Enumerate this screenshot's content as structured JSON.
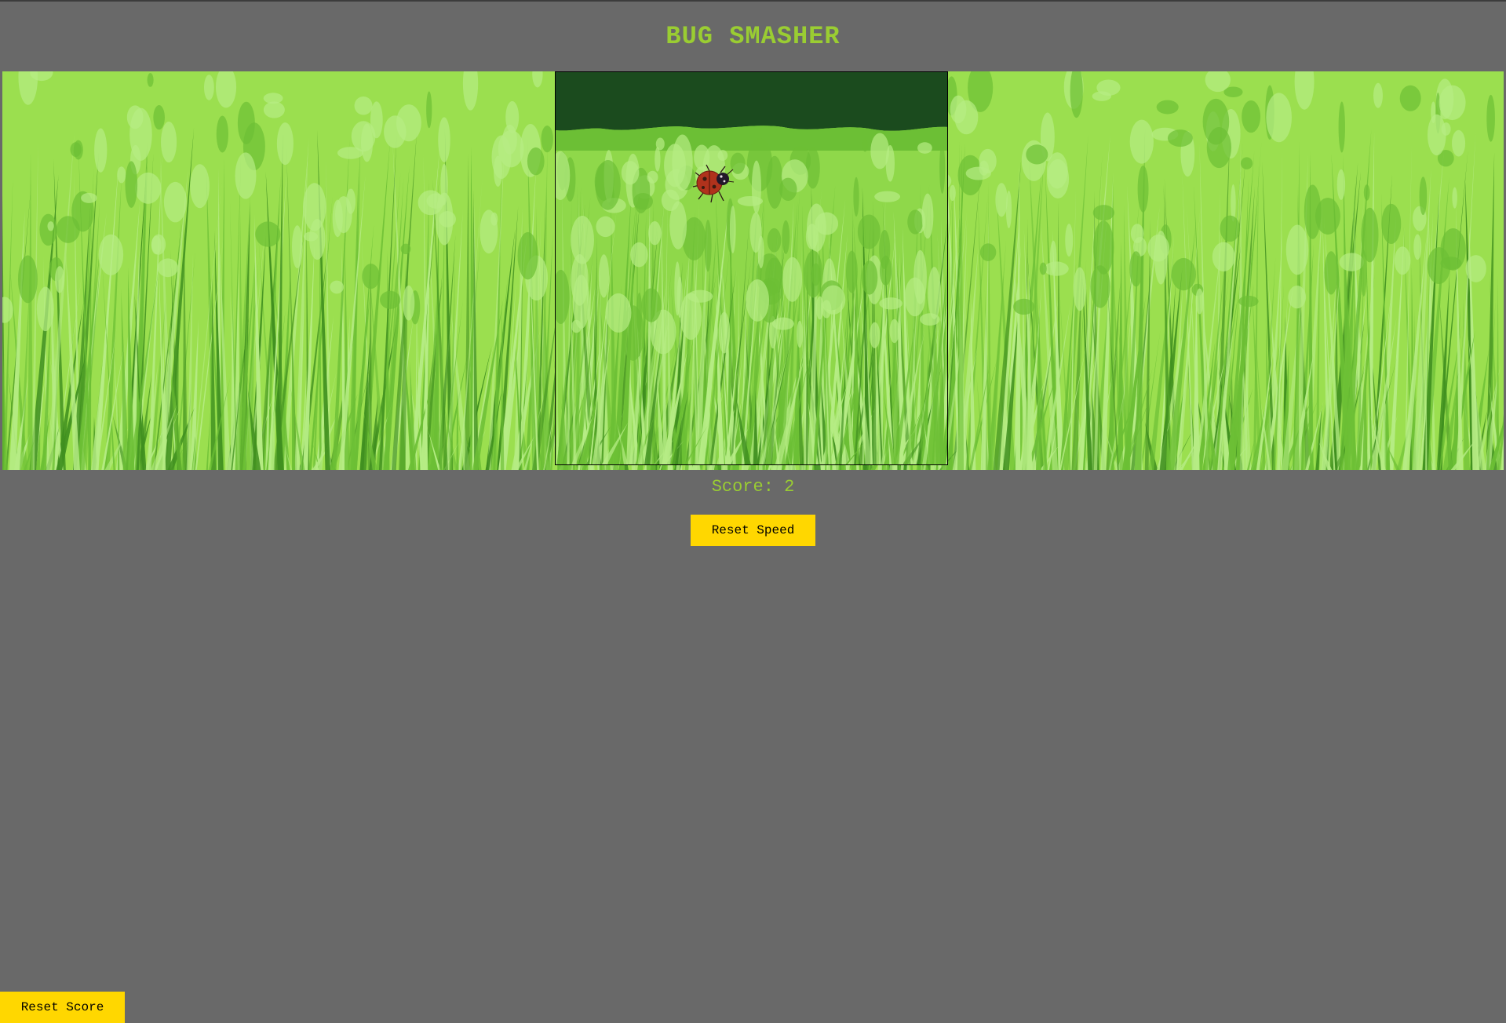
{
  "game": {
    "title": "BUG SMASHER",
    "score_label": "Score: 2",
    "score": 2
  },
  "buttons": {
    "reset_speed": "Reset Speed",
    "reset_score": "Reset Score"
  },
  "colors": {
    "background": "#696969",
    "title": "#9acd32",
    "score": "#9acd32",
    "button": "#ffd700",
    "grass_light": "#9bdf4f",
    "grass_pale": "#b6ec85",
    "grass_mid": "#6cbf35",
    "grass_dark": "#3f8f1f",
    "tree_line": "#1b4b1e"
  },
  "sprites": {
    "bug": "ladybug",
    "background": "grass"
  }
}
